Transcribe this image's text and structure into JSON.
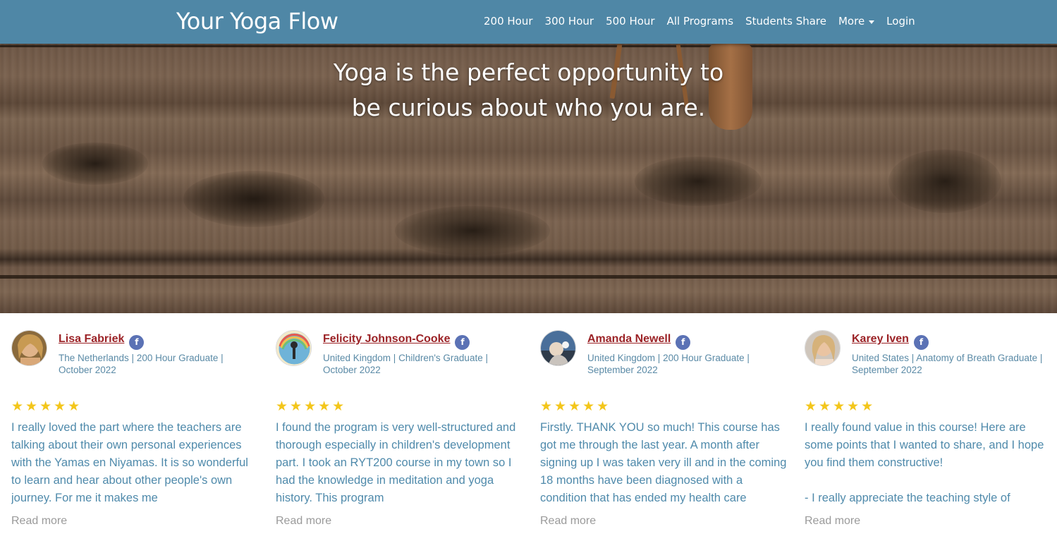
{
  "navbar": {
    "brand": "Your Yoga Flow",
    "links": [
      "200 Hour",
      "300 Hour",
      "500 Hour",
      "All Programs",
      "Students Share",
      "More",
      "Login"
    ],
    "color": "#4f87a6"
  },
  "hero": {
    "quote_line1": "Yoga is the perfect opportunity to",
    "quote_line2": "be curious about who you are."
  },
  "reviews": [
    {
      "name": "Lisa Fabriek",
      "meta": "The Netherlands | 200 Hour Graduate | October 2022",
      "stars": "★★★★★",
      "text": "I really loved the part where the teachers are talking about their own personal experiences with the Yamas en Niyamas. It is so wonderful to learn and hear about other people's own journey. For me it makes me",
      "read_more": "Read more",
      "social_icon": "f"
    },
    {
      "name": "Felicity Johnson-Cooke",
      "meta": "United Kingdom | Children's Graduate | October 2022",
      "stars": "★★★★★",
      "text": "I found the program is very well-structured and thorough especially in children's development part. I took an RYT200 course in my town so I had the knowledge in meditation and yoga history. This program",
      "read_more": "Read more",
      "social_icon": "f"
    },
    {
      "name": "Amanda Newell",
      "meta": "United Kingdom | 200 Hour Graduate | September 2022",
      "stars": "★★★★★",
      "text": "Firstly. THANK YOU so much! This course has got me through the last year. A month after signing up I was taken very ill and in the coming 18 months have been diagnosed with a condition that has ended my health care",
      "read_more": "Read more",
      "social_icon": "f"
    },
    {
      "name": "Karey Iven",
      "meta": "United States | Anatomy of Breath Graduate | September 2022",
      "stars": "★★★★★",
      "text": "I really found value in this course! Here are some points that I wanted to share, and I hope you find them constructive!\n\n- I really appreciate the teaching style of",
      "read_more": "Read more",
      "social_icon": "f"
    }
  ]
}
